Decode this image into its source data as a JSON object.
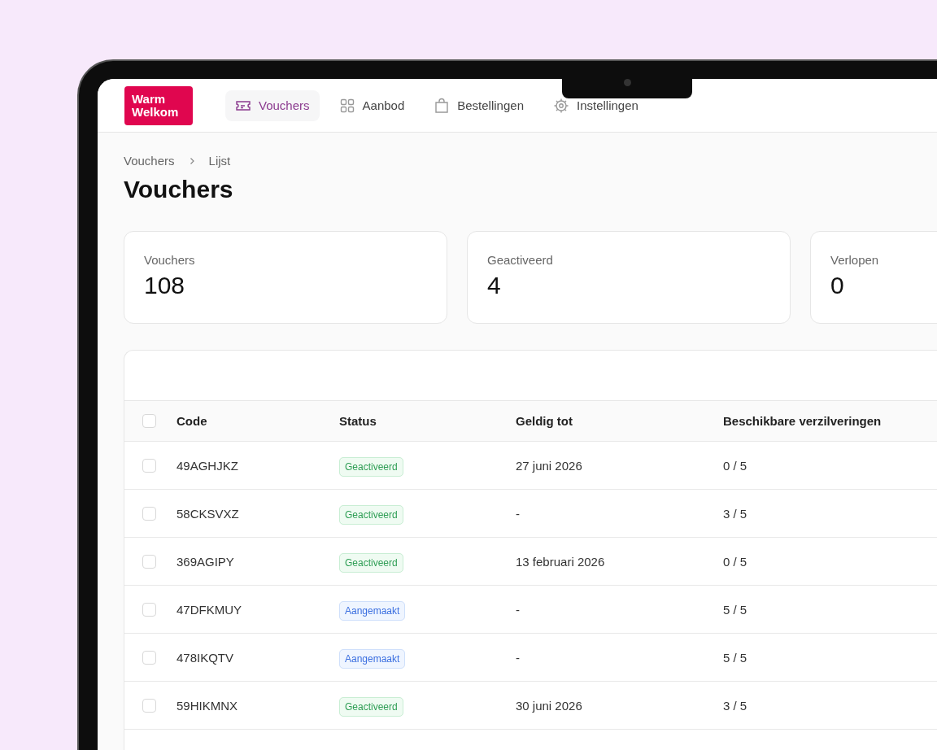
{
  "logo": {
    "lines": [
      "Warm",
      "Welkom"
    ]
  },
  "nav": [
    {
      "label": "Vouchers",
      "kind": "ticket",
      "selected": true
    },
    {
      "label": "Aanbod",
      "kind": "grid",
      "selected": false
    },
    {
      "label": "Bestellingen",
      "kind": "bag",
      "selected": false
    },
    {
      "label": "Instellingen",
      "kind": "gear",
      "selected": false
    }
  ],
  "breadcrumb": [
    "Vouchers",
    "Lijst"
  ],
  "title": "Vouchers",
  "stats": [
    {
      "label": "Vouchers",
      "value": "108"
    },
    {
      "label": "Geactiveerd",
      "value": "4"
    },
    {
      "label": "Verlopen",
      "value": "0"
    }
  ],
  "table": {
    "select_all": {
      "checked": false
    },
    "columns": [
      "Code",
      "Status",
      "Geldig tot",
      "Beschikbare verzilveringen"
    ],
    "rows": [
      {
        "checked": false,
        "code": "49AGHJKZ",
        "status": "Geactiveerd",
        "kind": "activated",
        "valid_until": "27 juni 2026",
        "redemptions": "0 / 5"
      },
      {
        "checked": false,
        "code": "58CKSVXZ",
        "status": "Geactiveerd",
        "kind": "activated",
        "valid_until": "-",
        "redemptions": "3 / 5"
      },
      {
        "checked": false,
        "code": "369AGIPY",
        "status": "Geactiveerd",
        "kind": "activated",
        "valid_until": "13 februari 2026",
        "redemptions": "0 / 5"
      },
      {
        "checked": false,
        "code": "47DFKMUY",
        "status": "Aangemaakt",
        "kind": "created",
        "valid_until": "-",
        "redemptions": "5 / 5"
      },
      {
        "checked": false,
        "code": "478IKQTV",
        "status": "Aangemaakt",
        "kind": "created",
        "valid_until": "-",
        "redemptions": "5 / 5"
      },
      {
        "checked": false,
        "code": "59HIKMNX",
        "status": "Geactiveerd",
        "kind": "activated",
        "valid_until": "30 juni 2026",
        "redemptions": "3 / 5"
      }
    ]
  }
}
